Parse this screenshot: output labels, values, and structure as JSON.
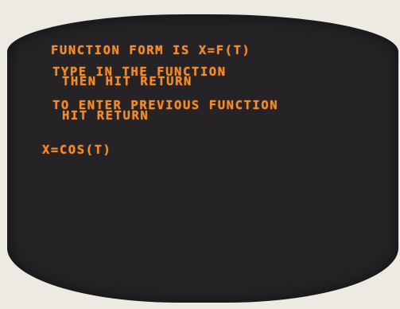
{
  "terminal": {
    "prompt_form": "FUNCTION FORM IS X=F(T)",
    "instruction_line1": "TYPE IN THE FUNCTION",
    "instruction_line2": "THEN HIT RETURN",
    "previous_line1": "TO ENTER PREVIOUS FUNCTION",
    "previous_line2": "HIT RETURN",
    "input_value": "X=COS(T)"
  },
  "colors": {
    "phosphor": "#f58a2a",
    "screen": "#252325",
    "bezel": "#eceae3"
  }
}
